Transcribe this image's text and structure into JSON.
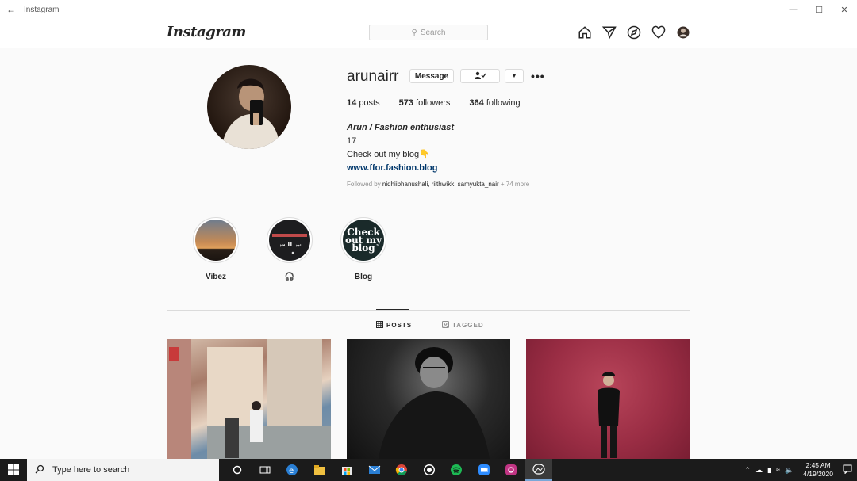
{
  "window": {
    "title": "Instagram"
  },
  "nav": {
    "logo": "Instagram",
    "search_placeholder": "Search"
  },
  "profile": {
    "username": "arunairr",
    "message_label": "Message",
    "stats": [
      {
        "count": "14",
        "label": "posts"
      },
      {
        "count": "573",
        "label": "followers"
      },
      {
        "count": "364",
        "label": "following"
      }
    ],
    "bio": {
      "name": "Arun / Fashion enthusiast",
      "line1": "17",
      "line2": "Check out my blog👇",
      "link": "www.ffor.fashion.blog"
    },
    "followed_by": {
      "prefix": "Followed by ",
      "names": "nidhiibhanushali, riithwikk, samyukta_nair",
      "suffix": " + 74 more"
    }
  },
  "highlights": [
    {
      "label": "Vibez"
    },
    {
      "label": "🎧"
    },
    {
      "label": "Blog",
      "cover_text": [
        "Check",
        "out my",
        "blog"
      ]
    }
  ],
  "tabs": [
    {
      "label": "POSTS",
      "icon": "grid-icon",
      "active": true
    },
    {
      "label": "TAGGED",
      "icon": "tag-icon",
      "active": false
    }
  ],
  "taskbar": {
    "search_placeholder": "Type here to search",
    "time": "2:45 AM",
    "date": "4/19/2020"
  }
}
